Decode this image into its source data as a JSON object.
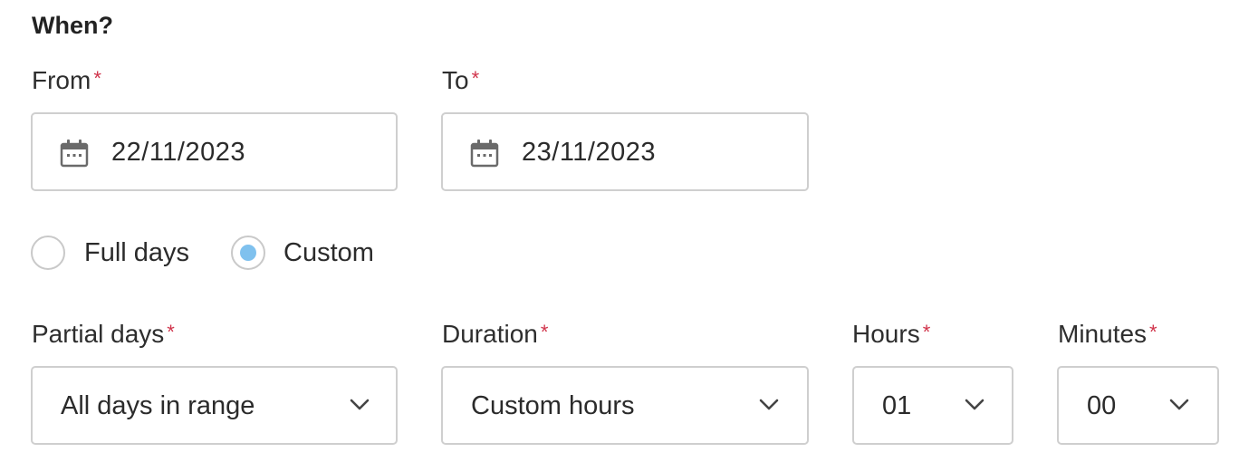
{
  "section": {
    "title": "When?"
  },
  "required_marker": "*",
  "from": {
    "label": "From",
    "value": "22/11/2023",
    "icon": "calendar-icon"
  },
  "to": {
    "label": "To",
    "value": "23/11/2023",
    "icon": "calendar-icon"
  },
  "day_mode": {
    "options": [
      {
        "label": "Full days",
        "selected": false
      },
      {
        "label": "Custom",
        "selected": true
      }
    ],
    "accent_color": "#7fc1ee"
  },
  "partial_days": {
    "label": "Partial days",
    "selected": "All days in range",
    "icon": "chevron-down-icon"
  },
  "duration": {
    "label": "Duration",
    "selected": "Custom hours",
    "icon": "chevron-down-icon"
  },
  "hours": {
    "label": "Hours",
    "selected": "01",
    "icon": "chevron-down-icon"
  },
  "minutes": {
    "label": "Minutes",
    "selected": "00",
    "icon": "chevron-down-icon"
  },
  "colors": {
    "required": "#d0334a",
    "border": "#cfcfcf",
    "text": "#2b2b2b"
  }
}
